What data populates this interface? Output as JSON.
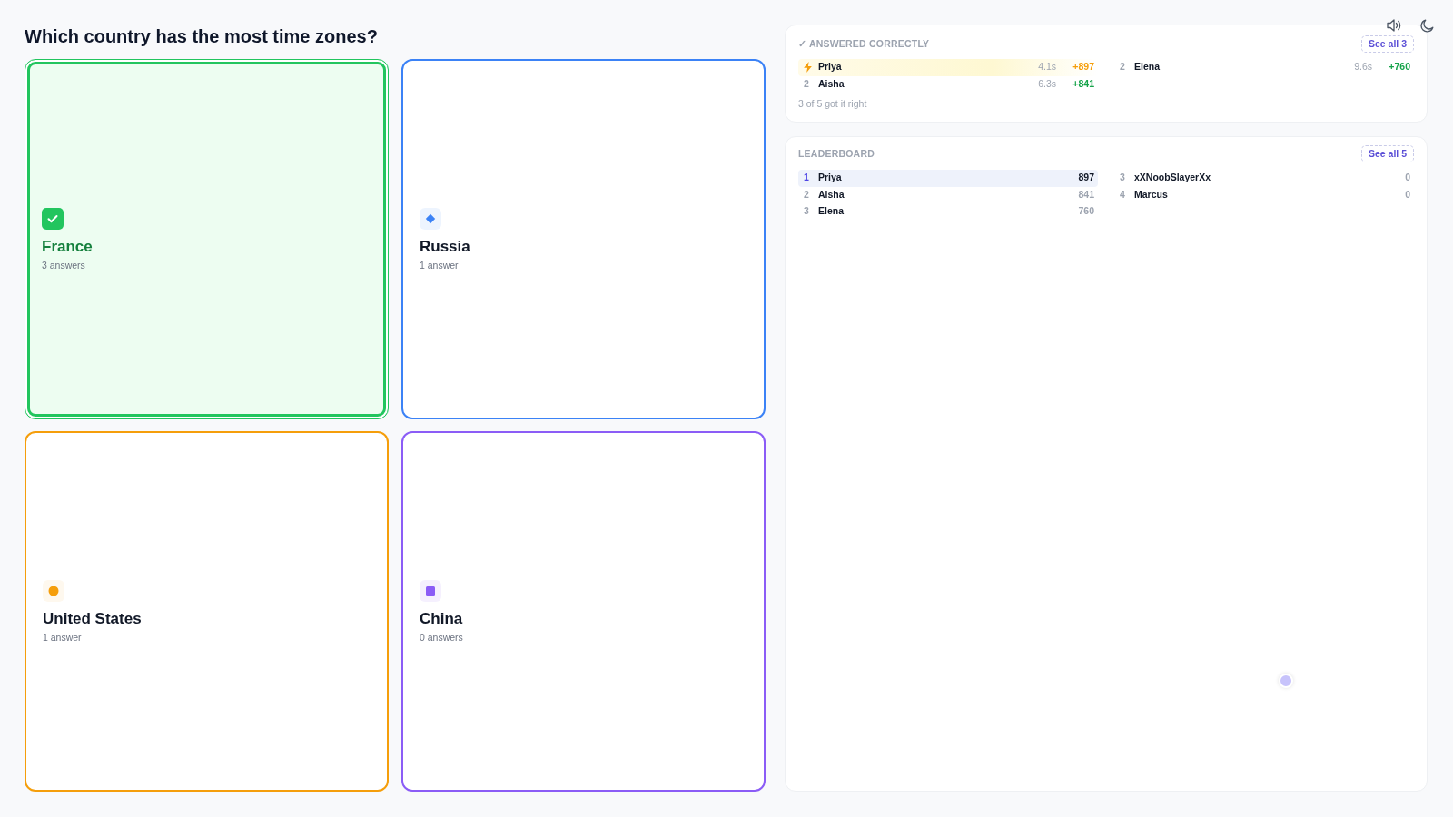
{
  "question": "Which country has the most time zones?",
  "options": [
    {
      "label": "France",
      "answers": "3 answers",
      "color": "#22c55e",
      "kind": "check",
      "correct": true
    },
    {
      "label": "Russia",
      "answers": "1 answer",
      "color": "#3b82f6",
      "kind": "diamond",
      "correct": false
    },
    {
      "label": "United States",
      "answers": "1 answer",
      "color": "#f59e0b",
      "kind": "circle",
      "correct": false
    },
    {
      "label": "China",
      "answers": "0 answers",
      "color": "#8b5cf6",
      "kind": "square",
      "correct": false
    }
  ],
  "answered_correctly": {
    "title": "✓ ANSWERED CORRECTLY",
    "see_all": "See all 3",
    "rows": [
      {
        "name": "Priya",
        "time": "4.1s",
        "points": "+897",
        "fastest": true
      },
      {
        "rank": "2",
        "name": "Aisha",
        "time": "6.3s",
        "points": "+841",
        "fastest": false
      },
      {
        "rank": "2",
        "name": "Elena",
        "time": "9.6s",
        "points": "+760",
        "fastest": false
      }
    ],
    "summary": "3 of 5 got it right"
  },
  "leaderboard": {
    "title": "LEADERBOARD",
    "see_all": "See all 5",
    "rows": [
      {
        "rank": "1",
        "name": "Priya",
        "score": "897",
        "highlighted": true
      },
      {
        "rank": "2",
        "name": "Aisha",
        "score": "841",
        "highlighted": false
      },
      {
        "rank": "3",
        "name": "Elena",
        "score": "760",
        "highlighted": false
      },
      {
        "rank": "3",
        "name": "xXNoobSlayerXx",
        "score": "0",
        "highlighted": false
      },
      {
        "rank": "4",
        "name": "Marcus",
        "score": "0",
        "highlighted": false
      }
    ]
  }
}
